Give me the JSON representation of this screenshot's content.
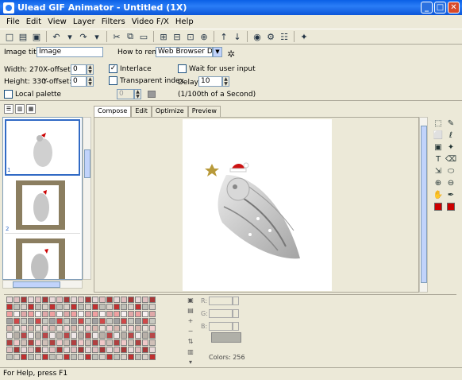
{
  "window": {
    "title": "Ulead GIF Animator - Untitled (1X)",
    "minimize": "_",
    "maximize": "□",
    "close": "✕"
  },
  "menu": [
    "File",
    "Edit",
    "View",
    "Layer",
    "Filters",
    "Video F/X",
    "Help"
  ],
  "toolbar_icons": [
    "new-icon",
    "open-icon",
    "save-icon",
    "sep",
    "undo-icon",
    "undo-dropdown-icon",
    "redo-icon",
    "redo-dropdown-icon",
    "sep",
    "cut-icon",
    "copy-icon",
    "paste-icon",
    "sep",
    "add-frame-icon",
    "delete-frame-icon",
    "duplicate-frame-icon",
    "add-image-icon",
    "sep",
    "move-up-icon",
    "move-down-icon",
    "sep",
    "web-preview-icon",
    "optimize-icon",
    "properties-icon",
    "sep",
    "wizard-icon"
  ],
  "toolbar_glyphs": [
    "□",
    "▤",
    "▣",
    "",
    "↶",
    "▾",
    "↷",
    "▾",
    "",
    "✂",
    "⧉",
    "▭",
    "",
    "⊞",
    "⊟",
    "⊡",
    "⊕",
    "",
    "↑",
    "↓",
    "",
    "◉",
    "⚙",
    "☷",
    "",
    "✦"
  ],
  "attributes": {
    "image_title_label": "Image title:",
    "image_title_value": "Image",
    "how_to_remove_label": "How to remove:",
    "how_to_remove_value": "Web Browser Decide",
    "width_label": "Width: 270",
    "height_label": "Height: 330",
    "xoffset_label": "X-offset:",
    "xoffset_value": "0",
    "yoffset_label": "Y-offset:",
    "yoffset_value": "0",
    "interlace_label": "Interlace",
    "interlace_checked": true,
    "transparent_label": "Transparent index",
    "transparent_checked": false,
    "transparent_value": "0",
    "wait_label": "Wait for user input",
    "wait_checked": false,
    "delay_label": "Delay:",
    "delay_value": "10",
    "delay_hint": "(1/100th of a Second)",
    "local_palette_label": "Local palette",
    "local_palette_checked": false
  },
  "frames": [
    {
      "number": "1",
      "selected": true,
      "bg": "#ffffff",
      "inner": "#ffffff"
    },
    {
      "number": "2",
      "selected": false,
      "bg": "#8b7e60",
      "inner": "#ffffff"
    },
    {
      "number": "3",
      "selected": false,
      "bg": "#8b7e60",
      "inner": "#ffffff"
    }
  ],
  "workspace_tabs": [
    "Compose",
    "Edit",
    "Optimize",
    "Preview"
  ],
  "active_workspace_tab": "Compose",
  "tools": [
    "pick-tool-icon",
    "pen-tool-icon",
    "marquee-icon",
    "lasso-icon",
    "crop-icon",
    "wand-icon",
    "text-icon",
    "eraser-icon",
    "transform-icon",
    "fill-icon",
    "zoom-in-icon",
    "zoom-out-icon",
    "hand-icon",
    "eyedropper-icon"
  ],
  "tool_glyphs": [
    "⬚",
    "✎",
    "⬜",
    "ℓ",
    "▣",
    "✦",
    "T",
    "⌫",
    "⇲",
    "⬭",
    "⊕",
    "⊖",
    "✋",
    "✒"
  ],
  "fg_color": "#cc0000",
  "bg_color": "#cc0000",
  "palette_colors": [
    "#e8d8d8",
    "#c03030",
    "#f0a0a0",
    "#a0a0a0",
    "#d8b8b0",
    "#f0e8e8",
    "#b04040",
    "#e0c0c0",
    "#c0c0b8",
    "#f8f0f0",
    "#d04848",
    "#e8e0d8",
    "#b8b0a8",
    "#f0c8c8",
    "#a83838",
    "#d8d0c8",
    "#e0a8a8",
    "#c8c8c0",
    "#f0d0d0",
    "#b84848",
    "#d0c0b8"
  ],
  "palette_cell_count": 189,
  "palette_tools": [
    "save-palette-icon",
    "load-palette-icon",
    "add-color-icon",
    "delete-color-icon",
    "sort-palette-icon",
    "edit-palette-icon",
    "palette-menu-icon"
  ],
  "palette_tool_glyphs": [
    "▣",
    "▤",
    "+",
    "−",
    "⇅",
    "▥",
    "▾"
  ],
  "rgb": {
    "r_label": "R:",
    "g_label": "G:",
    "b_label": "B:",
    "r_value": "0",
    "g_value": "0",
    "b_value": "0"
  },
  "colors_count": "Colors: 256",
  "status": "For Help, press F1"
}
